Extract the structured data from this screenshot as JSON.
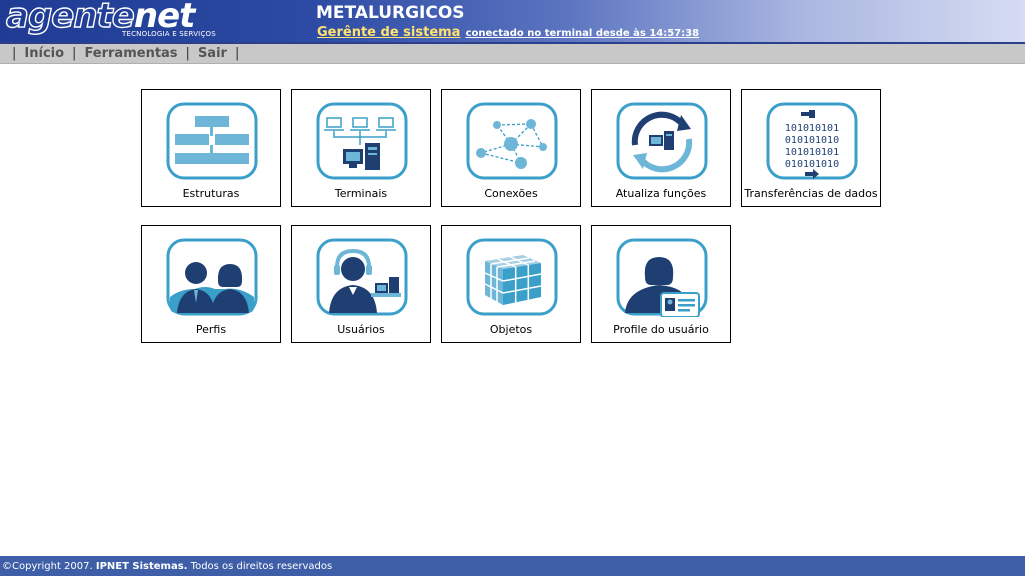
{
  "header": {
    "logo_text_main": "agente",
    "logo_text_net": "net",
    "logo_subtitle": "TECNOLOGIA E SERVIÇOS",
    "company": "METALURGICOS",
    "role": "Gerênte de sistema",
    "since": "conectado no terminal desde às 14:57:38"
  },
  "menu": {
    "items": [
      "Início",
      "Ferramentas",
      "Sair"
    ]
  },
  "tiles": [
    {
      "label": "Estruturas",
      "icon": "structure-icon"
    },
    {
      "label": "Terminais",
      "icon": "terminals-icon"
    },
    {
      "label": "Conexões",
      "icon": "network-icon"
    },
    {
      "label": "Atualiza funções",
      "icon": "refresh-computer-icon"
    },
    {
      "label": "Transferências de dados",
      "icon": "binary-transfer-icon"
    },
    {
      "label": "Perfis",
      "icon": "profiles-icon"
    },
    {
      "label": "Usuários",
      "icon": "user-headset-icon"
    },
    {
      "label": "Objetos",
      "icon": "cube-icon"
    },
    {
      "label": "Profile do usuário",
      "icon": "user-id-card-icon"
    }
  ],
  "binary_lines": [
    "101010101",
    "010101010",
    "101010101",
    "010101010"
  ],
  "footer": {
    "prefix": "©Copyright 2007. ",
    "brand": "IPNET Sistemas.",
    "suffix": " Todos os direitos reservados"
  },
  "colors": {
    "icon_frame": "#3a9fc9",
    "icon_fill": "#6eb6d8",
    "icon_dark": "#1f3f72",
    "header_start": "#1f3b93",
    "footer_bg": "#3f5ea8"
  }
}
